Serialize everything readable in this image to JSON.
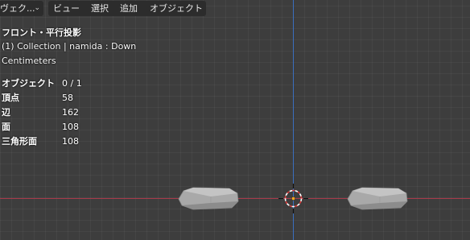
{
  "header": {
    "mode_label": "ヴェク...",
    "menu": [
      "ビュー",
      "選択",
      "追加",
      "オブジェクト"
    ]
  },
  "overlay": {
    "view_name": "フロント・平行投影",
    "collection_line": "(1) Collection | namida : Down",
    "units": "Centimeters"
  },
  "stats": [
    {
      "label": "オブジェクト",
      "value": "0 / 1"
    },
    {
      "label": "頂点",
      "value": "58"
    },
    {
      "label": "辺",
      "value": "162"
    },
    {
      "label": "面",
      "value": "108"
    },
    {
      "label": "三角形面",
      "value": "108"
    }
  ],
  "colors": {
    "background": "#3d3d3d",
    "x_axis": "#a83a4a",
    "z_axis": "#3b6fbf",
    "object": "#b4b4b4",
    "cursor_red": "#e03a3a",
    "origin": "#f5a623"
  }
}
